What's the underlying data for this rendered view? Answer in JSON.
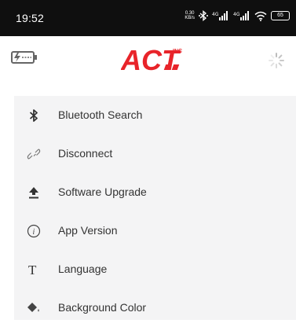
{
  "status_bar": {
    "time": "19:52",
    "speed_value": "0.30",
    "speed_unit": "KB/s",
    "battery_level": "65",
    "icons": [
      "bluetooth-icon",
      "signal-4g-icon",
      "signal-4g-icon",
      "wifi-icon",
      "battery-icon"
    ]
  },
  "header": {
    "logo_text": "ACT",
    "logo_small": "INC",
    "left_icon": "battery-charging-icon",
    "right_icon": "loading-spinner-icon"
  },
  "colors": {
    "brand_red": "#e8242a",
    "status_bg": "#0f0f0f",
    "menu_bg": "#f4f4f5",
    "text": "#333333"
  },
  "menu": {
    "items": [
      {
        "label": "Bluetooth Search",
        "icon": "bluetooth-icon"
      },
      {
        "label": "Disconnect",
        "icon": "link-broken-icon"
      },
      {
        "label": "Software Upgrade",
        "icon": "upload-icon"
      },
      {
        "label": "App Version",
        "icon": "info-icon"
      },
      {
        "label": "Language",
        "icon": "text-t-icon"
      },
      {
        "label": "Background Color",
        "icon": "paint-bucket-icon"
      }
    ]
  }
}
